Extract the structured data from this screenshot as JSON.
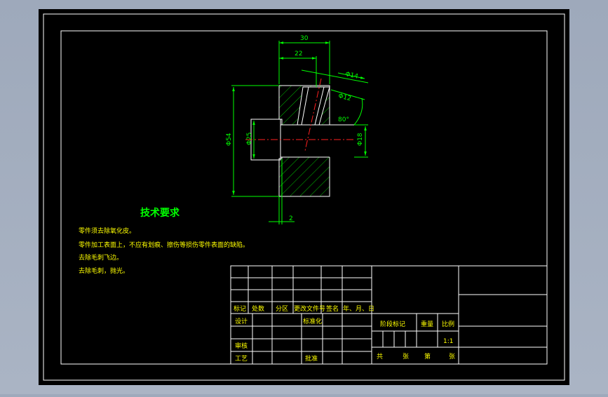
{
  "drawing": {
    "dims": {
      "d30": "30",
      "d22": "22",
      "phi14": "Φ14",
      "phi12": "Φ12",
      "angle": "80°",
      "phi54": "Φ54",
      "phi25": "Φ25",
      "phi18": "Φ18",
      "d2": "2"
    },
    "tech_title": "技术要求",
    "tech_notes": [
      "零件须去除氧化皮。",
      "零件加工表面上，不应有划痕、擦伤等损伤零件表面的缺陷。",
      "去除毛刺飞边。",
      "去除毛刺，抛光。"
    ],
    "title_block": {
      "mark": "标记",
      "count": "处数",
      "zone": "分区",
      "change_doc": "更改文件号",
      "sign": "签名",
      "date": "年、月、日",
      "design": "设计",
      "standardize": "标准化",
      "review": "审核",
      "process": "工艺",
      "approve": "批准",
      "stage_mark": "阶段标记",
      "weight": "重量",
      "scale": "比例",
      "scale_value": "1:1",
      "total": "共",
      "sheets": "张",
      "page_no": "第",
      "page": "张"
    }
  },
  "colors": {
    "background_gray": "#a3adbf",
    "paper": "#000000",
    "line_white": "#ffffff",
    "dimension_green": "#00ff00",
    "hatch_green": "#00c000",
    "centerline_red": "#ff2020",
    "tech_yellow": "#ffff00"
  }
}
